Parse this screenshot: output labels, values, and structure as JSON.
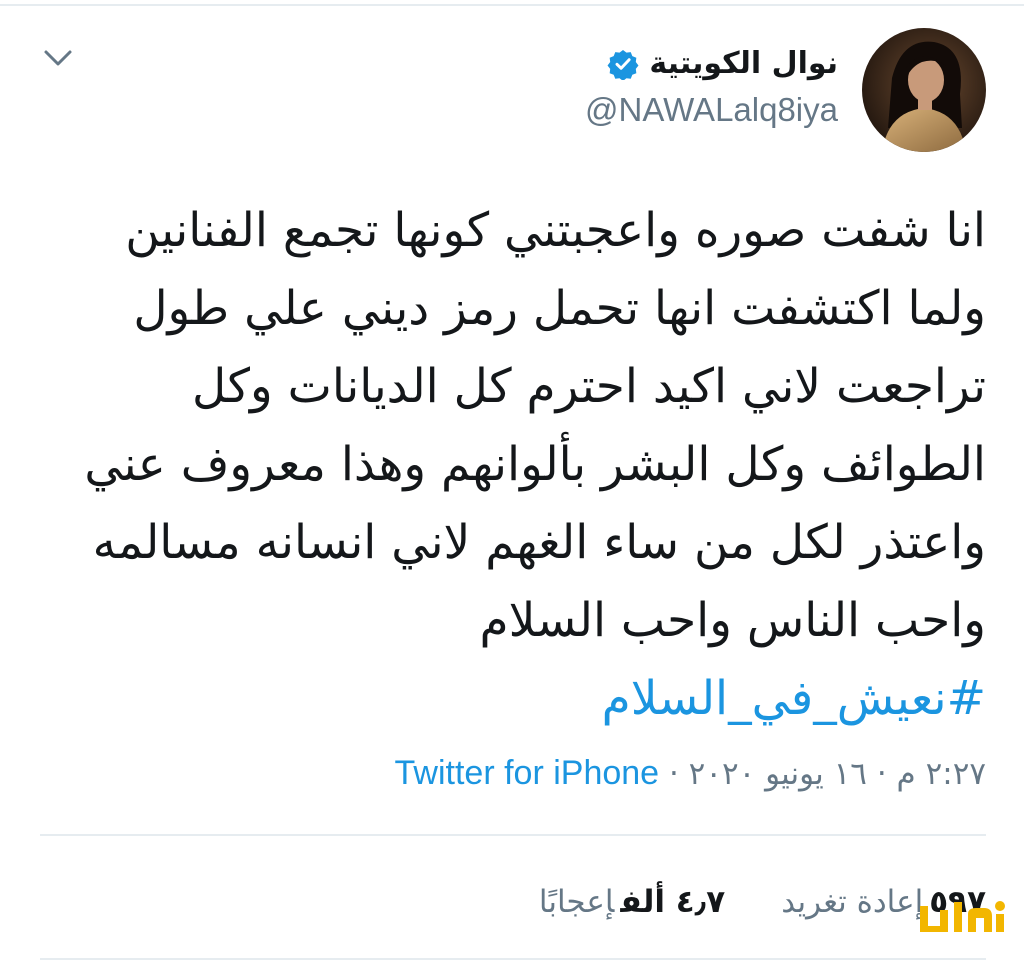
{
  "author": {
    "display_name": "نوال الكويتية",
    "handle": "@NAWALalq8iya",
    "verified": true
  },
  "tweet": {
    "lines": [
      "انا شفت صوره واعجبتني كونها تجمع الفنانين",
      "ولما اكتشفت انها تحمل رمز ديني علي طول",
      "تراجعت لاني اكيد احترم كل الديانات وكل",
      "الطوائف وكل البشر بألوانهم وهذا معروف عني",
      "واعتذر لكل من ساء الغهم لاني انسانه مسالمه",
      "واحب الناس واحب السلام"
    ],
    "hashtag": "#نعيش_في_السلام"
  },
  "meta": {
    "time": "٢:٢٧ م",
    "separator": "·",
    "date": "١٦ يونيو ٢٠٢٠",
    "source": "Twitter for iPhone"
  },
  "stats": {
    "retweets": {
      "count": "٥٩٧",
      "label": "إعادة تغريد"
    },
    "likes": {
      "count": "٤٫٧ ألف",
      "label": "إعجابًا"
    }
  },
  "icons": {
    "menu": "chevron-down-icon",
    "verified": "verified-badge-icon"
  },
  "colors": {
    "link": "#1b95e0",
    "secondary_text": "#657786",
    "divider": "#e6ecf0",
    "watermark": "#f2b600"
  }
}
